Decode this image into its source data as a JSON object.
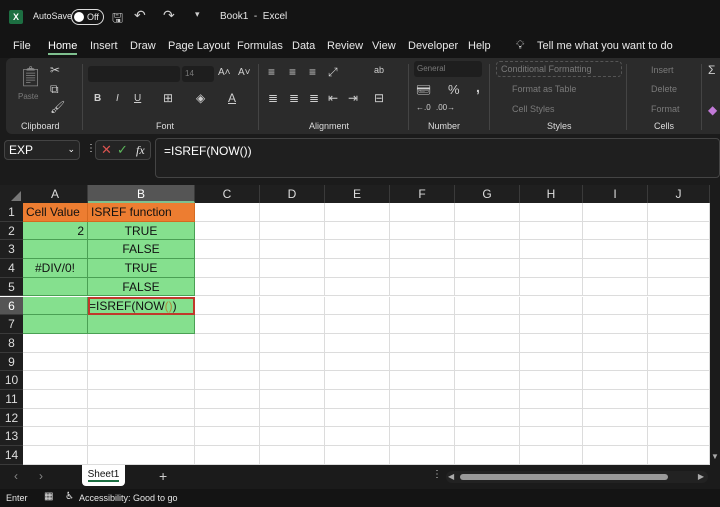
{
  "titlebar": {
    "autosave_label": "AutoSave",
    "autosave_state": "Off",
    "title": "Book1  -  Excel"
  },
  "menu": [
    "File",
    "Home",
    "Insert",
    "Draw",
    "Page Layout",
    "Formulas",
    "Data",
    "Review",
    "View",
    "Developer",
    "Help"
  ],
  "tell_me": "Tell me what you want to do",
  "ribbon": {
    "clipboard": {
      "label": "Clipboard",
      "paste": "Paste"
    },
    "font": {
      "label": "Font",
      "size": "14",
      "bold": "B",
      "italic": "I",
      "underline": "U"
    },
    "alignment": {
      "label": "Alignment"
    },
    "number": {
      "label": "Number",
      "format": "General",
      "percent": "%",
      "comma": ","
    },
    "styles": {
      "label": "Styles",
      "conditional": "Conditional Formatting",
      "format_table": "Format as Table",
      "cell_styles": "Cell Styles"
    },
    "cells": {
      "label": "Cells",
      "insert": "Insert",
      "delete": "Delete",
      "format": "Format"
    }
  },
  "formula_bar": {
    "name_box": "EXP",
    "formula": "=ISREF(NOW())",
    "fx": "fx"
  },
  "columns": [
    "A",
    "B",
    "C",
    "D",
    "E",
    "F",
    "G",
    "H",
    "I",
    "J"
  ],
  "rows": [
    "1",
    "2",
    "3",
    "4",
    "5",
    "6",
    "7",
    "8",
    "9",
    "10",
    "11",
    "12",
    "13",
    "14"
  ],
  "cells": {
    "A1": "Cell Value",
    "B1": "ISREF function",
    "A2": "2",
    "B2": "TRUE",
    "B3": "FALSE",
    "A4": "#DIV/0!",
    "B4": "TRUE",
    "B5": "FALSE",
    "B6_a": "=ISREF(NOW",
    "B6_b": "()",
    "B6_c": ")"
  },
  "colors": {
    "header_fill": "#ed7d31",
    "data_fill": "#85e08e",
    "edit_border": "#c0392b"
  },
  "sheet_tab": "Sheet1",
  "status": {
    "mode": "Enter",
    "accessibility": "Accessibility: Good to go"
  }
}
